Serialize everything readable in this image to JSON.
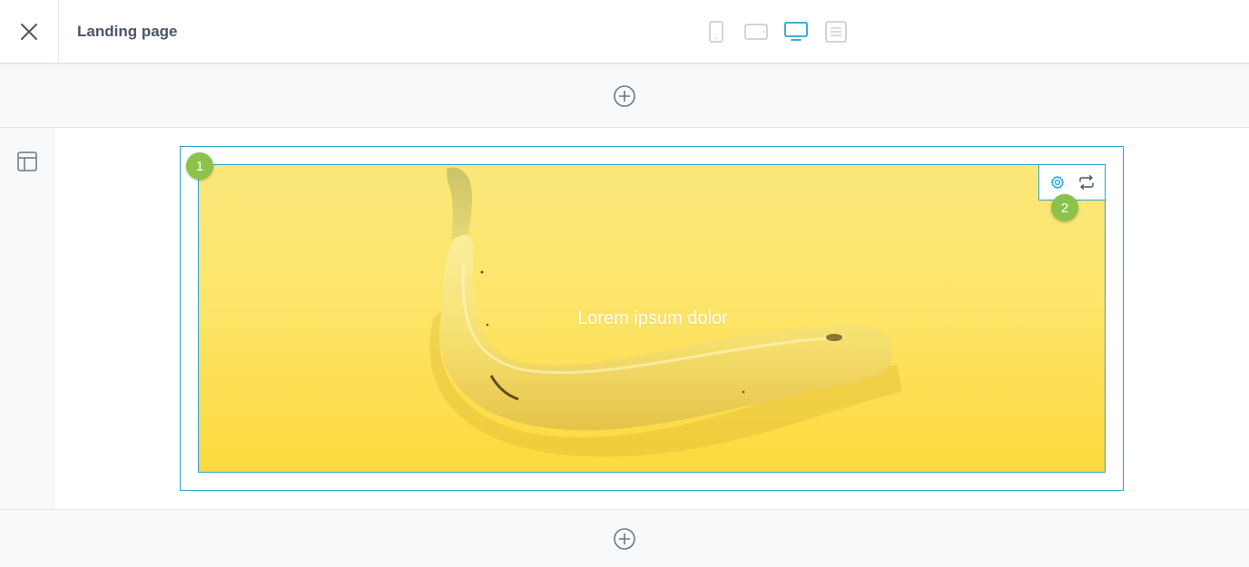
{
  "header": {
    "title": "Landing page",
    "close_icon": "close-icon",
    "devices": [
      {
        "name": "mobile",
        "icon": "phone-icon",
        "active": false
      },
      {
        "name": "tablet",
        "icon": "tablet-icon",
        "active": false
      },
      {
        "name": "desktop",
        "icon": "desktop-icon",
        "active": true
      },
      {
        "name": "document",
        "icon": "document-icon",
        "active": false
      }
    ]
  },
  "hero": {
    "text": "Lorem ipsum dolor",
    "background_image": "banana on yellow background"
  },
  "markers": {
    "one": "1",
    "two": "2"
  },
  "colors": {
    "accent": "#2aa3d6",
    "marker": "#8bc34a",
    "inactive_icon": "#c3c8cf"
  }
}
